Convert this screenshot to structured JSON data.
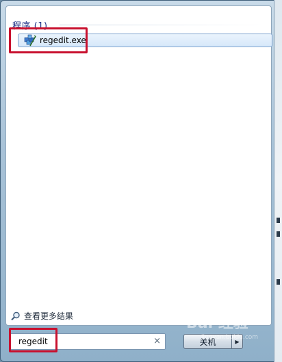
{
  "results": {
    "section_header": "程序 (1)",
    "items": [
      {
        "label": "regedit.exe",
        "icon": "registry-editor-icon"
      }
    ]
  },
  "more_results": {
    "label": "查看更多结果",
    "icon": "search-icon"
  },
  "search": {
    "value": "regedit",
    "clear_icon": "×"
  },
  "power": {
    "shutdown_label": "关机",
    "arrow_glyph": "▶"
  },
  "watermark": {
    "brand": "Bai 经验",
    "url": "jingyan.baidu.com"
  },
  "colors": {
    "header_text": "#1e3287",
    "highlight_red": "#c8102e",
    "selection_border": "#7da2ce"
  }
}
